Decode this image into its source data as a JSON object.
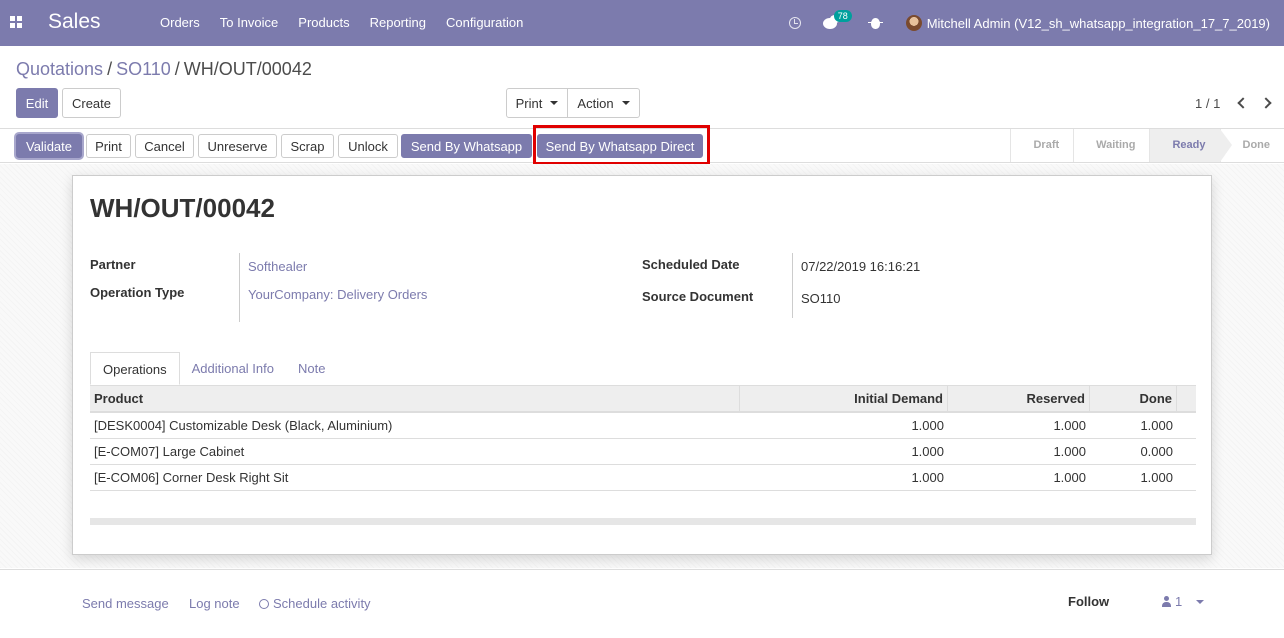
{
  "navbar": {
    "app_name": "Sales",
    "menu": [
      "Orders",
      "To Invoice",
      "Products",
      "Reporting",
      "Configuration"
    ],
    "messages_count": "78",
    "user": "Mitchell Admin (V12_sh_whatsapp_integration_17_7_2019)",
    "color": "#7c7bad"
  },
  "breadcrumb": {
    "items": [
      "Quotations",
      "SO110"
    ],
    "current": "WH/OUT/00042"
  },
  "control": {
    "edit": "Edit",
    "create": "Create",
    "print": "Print",
    "action": "Action",
    "pager": "1 / 1"
  },
  "statusbar": {
    "buttons": [
      "Validate",
      "Print",
      "Cancel",
      "Unreserve",
      "Scrap",
      "Unlock",
      "Send By Whatsapp",
      "Send By Whatsapp Direct"
    ],
    "stages": [
      "Draft",
      "Waiting",
      "Ready",
      "Done"
    ],
    "active_stage": "Ready"
  },
  "form": {
    "title": "WH/OUT/00042",
    "partner_label": "Partner",
    "partner": "Softhealer",
    "op_type_label": "Operation Type",
    "op_type": "YourCompany: Delivery Orders",
    "scheduled_label": "Scheduled Date",
    "scheduled": "07/22/2019 16:16:21",
    "source_label": "Source Document",
    "source": "SO110"
  },
  "tabs": [
    "Operations",
    "Additional Info",
    "Note"
  ],
  "table": {
    "headers": [
      "Product",
      "Initial Demand",
      "Reserved",
      "Done"
    ],
    "rows": [
      [
        "[DESK0004] Customizable Desk (Black, Aluminium)",
        "1.000",
        "1.000",
        "1.000"
      ],
      [
        "[E-COM07] Large Cabinet",
        "1.000",
        "1.000",
        "0.000"
      ],
      [
        "[E-COM06] Corner Desk Right Sit",
        "1.000",
        "1.000",
        "1.000"
      ]
    ]
  },
  "chatter": {
    "send_message": "Send message",
    "log_note": "Log note",
    "schedule_activity": "Schedule activity",
    "follow": "Follow",
    "followers": "1"
  }
}
